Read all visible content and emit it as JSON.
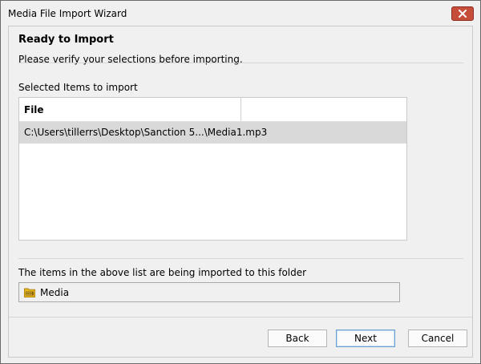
{
  "window": {
    "title": "Media File Import Wizard"
  },
  "colors": {
    "close_button": "#c74d3b",
    "selected_row": "#d9d9d9",
    "folder_icon": "#e8b820"
  },
  "header": {
    "title": "Ready to Import",
    "subtitle": "Please verify your selections before importing."
  },
  "selected_items": {
    "label": "Selected Items to import",
    "columns": [
      "File",
      ""
    ],
    "rows": [
      {
        "file": "C:\\Users\\tillerrs\\Desktop\\Sanction 5...\\Media1.mp3",
        "selected": true
      }
    ]
  },
  "destination": {
    "label": "The items in the above list are being imported to this folder",
    "folder_name": "Media",
    "folder_icon": "media-folder-icon"
  },
  "buttons": {
    "back": "Back",
    "next": "Next",
    "cancel": "Cancel"
  }
}
